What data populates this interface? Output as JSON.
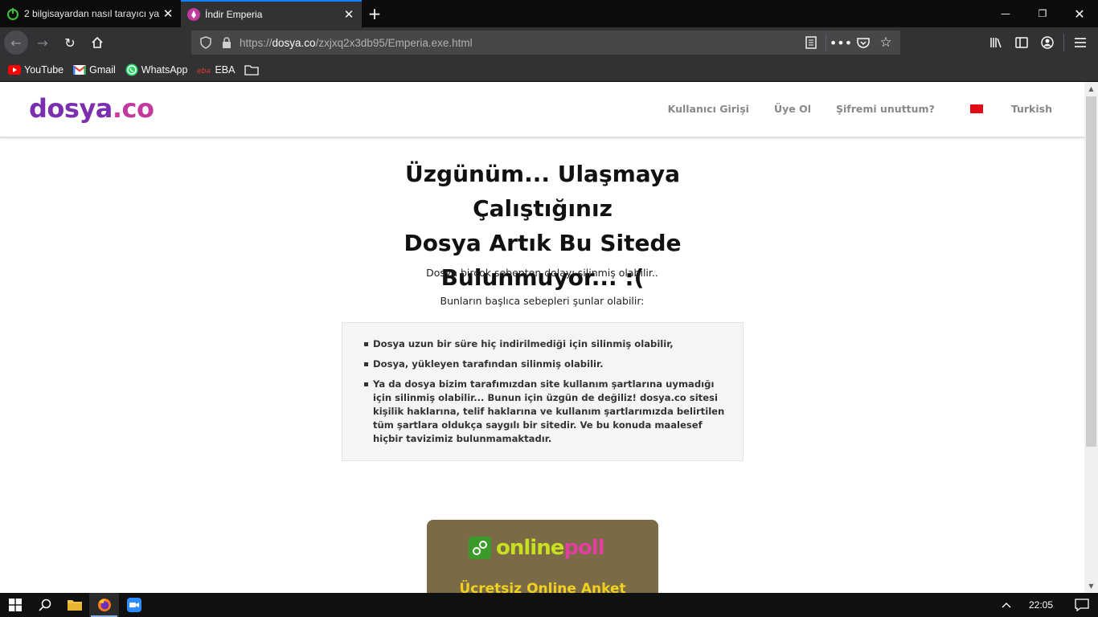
{
  "browser": {
    "tabs": [
      {
        "title": "2 bilgisayardan nasıl tarayıcı ya",
        "icon": "power-icon",
        "active": false
      },
      {
        "title": "İndir Emperia",
        "icon": "dosya-favicon",
        "active": true
      }
    ],
    "url_prefix": "https://",
    "url_host": "dosya.co",
    "url_path": "/zxjxq2x3db95/Emperia.exe.html",
    "bookmarks": [
      {
        "label": "YouTube",
        "icon": "youtube-icon"
      },
      {
        "label": "Gmail",
        "icon": "gmail-icon"
      },
      {
        "label": "WhatsApp",
        "icon": "whatsapp-icon"
      },
      {
        "label": "EBA",
        "icon": "eba-icon"
      }
    ]
  },
  "site": {
    "logo": {
      "part1": "dosya",
      "dot": ".",
      "part2": "co"
    },
    "nav": {
      "login": "Kullanıcı Girişi",
      "register": "Üye Ol",
      "forgot": "Şifremi unuttum?",
      "language": "Turkish"
    },
    "heading_line1": "Üzgünüm... Ulaşmaya Çalıştığınız",
    "heading_line2": "Dosya Artık Bu Sitede",
    "heading_line3": "Bulunmuyor... :(",
    "sub1": "Dosya birçok sebepten dolayı silinmiş olabilir..",
    "sub2": "Bunların başlıca sebepleri şunlar olabilir:",
    "reasons": [
      "Dosya uzun bir süre hiç indirilmediği için silinmiş olabilir,",
      "Dosya, yükleyen tarafından silinmiş olabilir.",
      "Ya da dosya bizim tarafımızdan site kullanım şartlarına uymadığı için silinmiş olabilir... Bunun için üzgün de değiliz! dosya.co sitesi kişilik haklarına, telif haklarına ve kullanım şartlarımızda belirtilen tüm şartlara oldukça saygılı bir sitedir. Ve bu konuda maalesef hiçbir tavizimiz bulunmamaktadır."
    ],
    "ad": {
      "brand_part1": "online",
      "brand_part2": "poll",
      "tagline": "Ücretsiz Online Anket Platformu"
    }
  },
  "taskbar": {
    "clock": "22:05"
  },
  "colors": {
    "brand": "#7b2fae",
    "accent_tab": "#0a84ff",
    "chrome_dark": "#0c0c0d",
    "chrome": "#323234"
  }
}
